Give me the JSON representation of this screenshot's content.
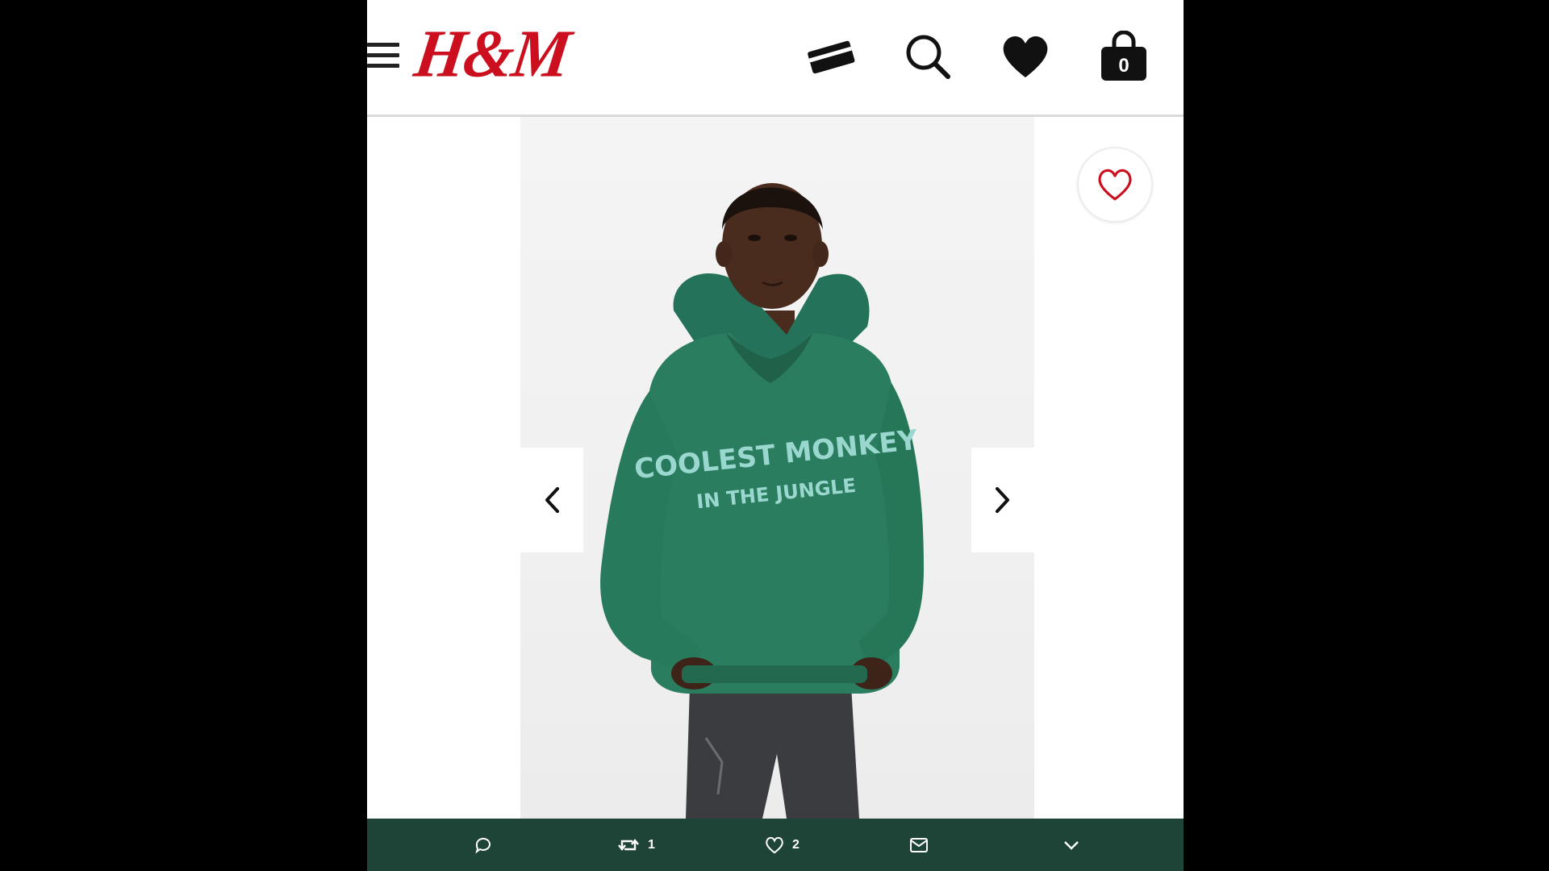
{
  "header": {
    "logo_text": "H&M",
    "logo_color": "#cc0f1e",
    "icons": [
      "menu-icon",
      "card-icon",
      "search-icon",
      "heart-icon",
      "bag-icon"
    ],
    "bag_count": "0"
  },
  "product": {
    "print_line1": "COOLEST MONKEY",
    "print_line2": "IN THE JUNGLE",
    "hoodie_color": "#2a7d5f"
  },
  "tweet_actions": {
    "reply_count": "",
    "retweet_count": "1",
    "like_count": "2"
  },
  "colors": {
    "action_bar": "#1e4438"
  }
}
